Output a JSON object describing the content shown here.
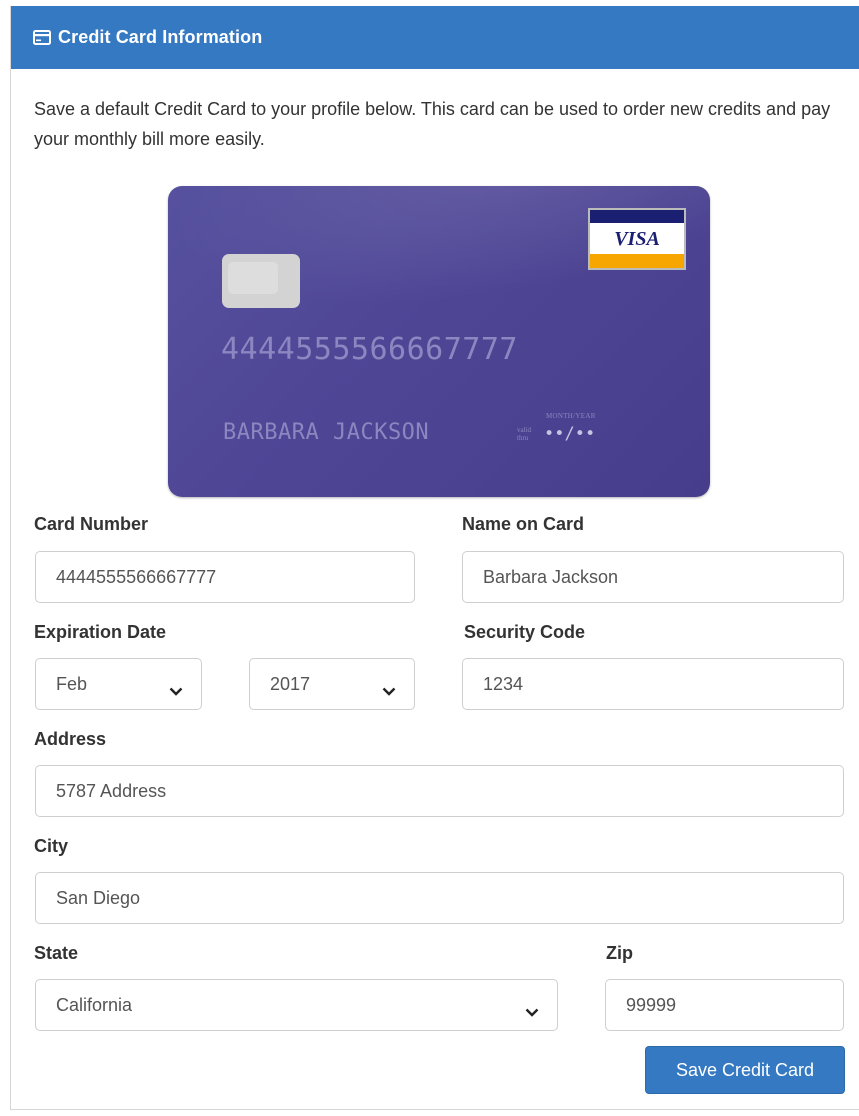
{
  "header": {
    "title": "Credit Card Information"
  },
  "intro": "Save a default Credit Card to your profile below. This card can be used to order new credits and pay your monthly bill more easily.",
  "card_preview": {
    "brand": "VISA",
    "number": "4444555566667777",
    "holder": "BARBARA JACKSON",
    "valid_thru_label": "valid thru",
    "month_year_label": "MONTH/YEAR",
    "expiry": "••/••"
  },
  "form": {
    "card_number": {
      "label": "Card Number",
      "value": "4444555566667777"
    },
    "name_on_card": {
      "label": "Name on Card",
      "value": "Barbara Jackson"
    },
    "expiration": {
      "label": "Expiration Date",
      "month": "Feb",
      "year": "2017"
    },
    "security_code": {
      "label": "Security Code",
      "value": "1234"
    },
    "address": {
      "label": "Address",
      "value": "5787 Address"
    },
    "city": {
      "label": "City",
      "value": "San Diego"
    },
    "state": {
      "label": "State",
      "value": "California"
    },
    "zip": {
      "label": "Zip",
      "value": "99999"
    },
    "save_label": "Save Credit Card"
  },
  "colors": {
    "header_bg": "#3479c2",
    "card_bg": "#4f4796",
    "button_bg": "#3479c2"
  },
  "icons": {
    "header": "credit-card-icon",
    "select": "chevron-down-icon"
  }
}
